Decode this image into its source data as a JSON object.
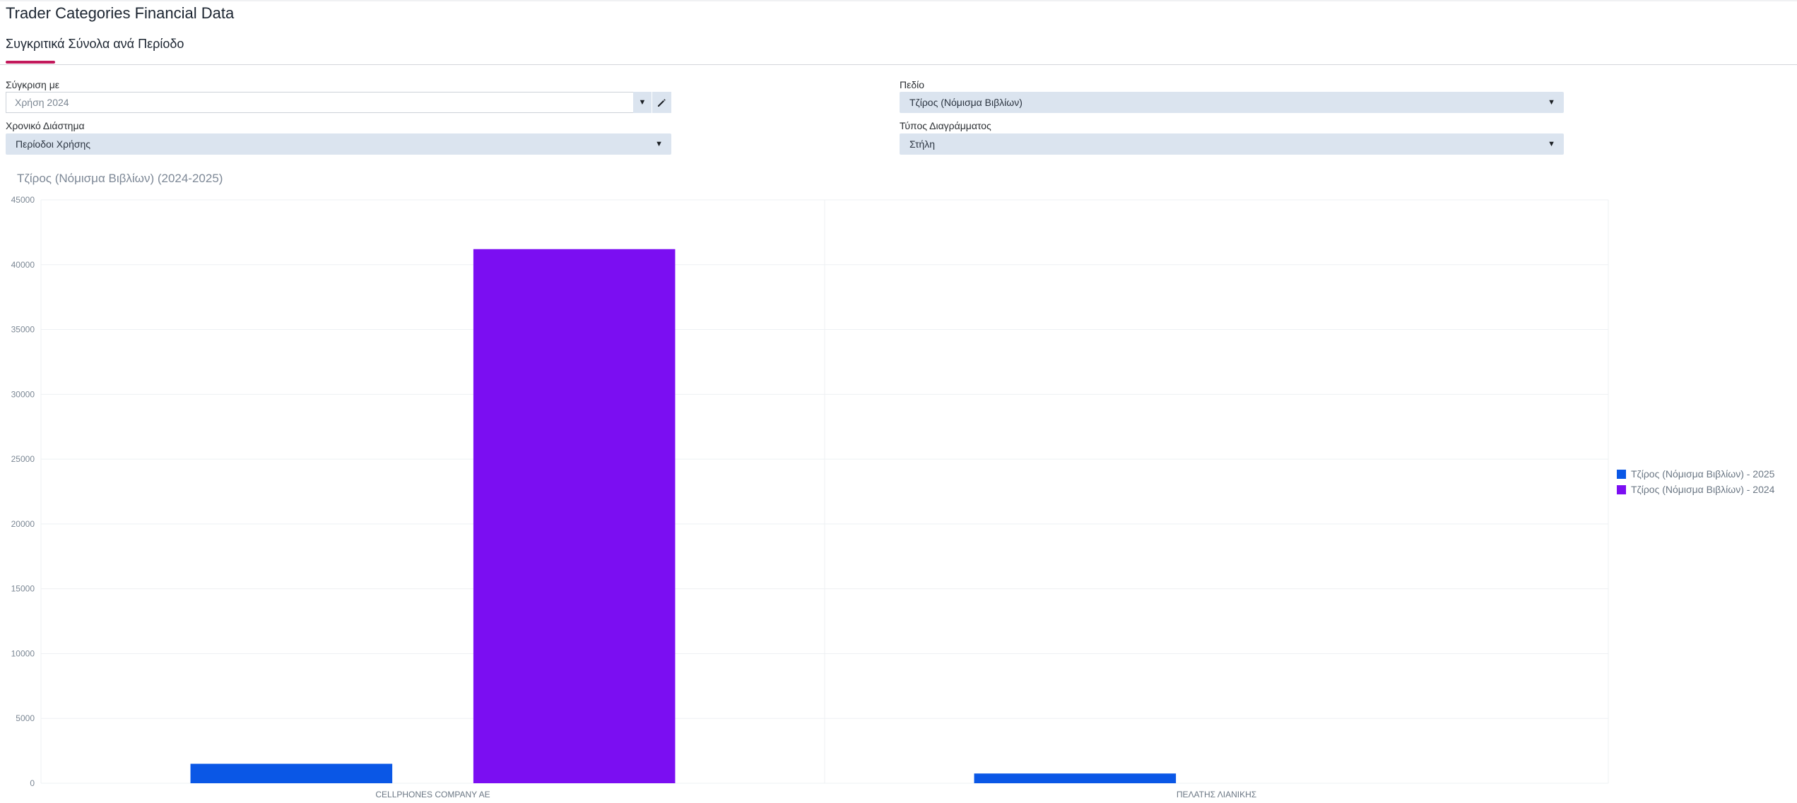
{
  "page": {
    "title": "Trader Categories Financial Data"
  },
  "tabs": [
    {
      "label": "Συγκριτικά Σύνολα ανά Περίοδο",
      "active": true
    }
  ],
  "filters": {
    "compare_with": {
      "label": "Σύγκριση με",
      "value": "Χρήση 2024"
    },
    "field": {
      "label": "Πεδίο",
      "value": "Τζίρος (Νόμισμα Βιβλίων)"
    },
    "time_range": {
      "label": "Χρονικό Διάστημα",
      "value": "Περίοδοι Χρήσης"
    },
    "chart_type": {
      "label": "Τύπος Διαγράμματος",
      "value": "Στήλη"
    }
  },
  "chart_data": {
    "type": "bar",
    "title": "Τζίρος (Νόμισμα Βιβλίων) (2024-2025)",
    "categories": [
      "CELLPHONES COMPANY AE",
      "ΠΕΛΑΤΗΣ ΛΙΑΝΙΚΗΣ"
    ],
    "series": [
      {
        "name": "Τζίρος (Νόμισμα Βιβλίων) - 2025",
        "color": "#0a57e6",
        "values": [
          1500,
          750
        ]
      },
      {
        "name": "Τζίρος (Νόμισμα Βιβλίων) - 2024",
        "color": "#7b0ef2",
        "values": [
          41200,
          0
        ]
      }
    ],
    "ylim": [
      0,
      45000
    ],
    "yticks": [
      0,
      5000,
      10000,
      15000,
      20000,
      25000,
      30000,
      35000,
      40000,
      45000
    ],
    "grid": true,
    "legend_position": "right"
  }
}
